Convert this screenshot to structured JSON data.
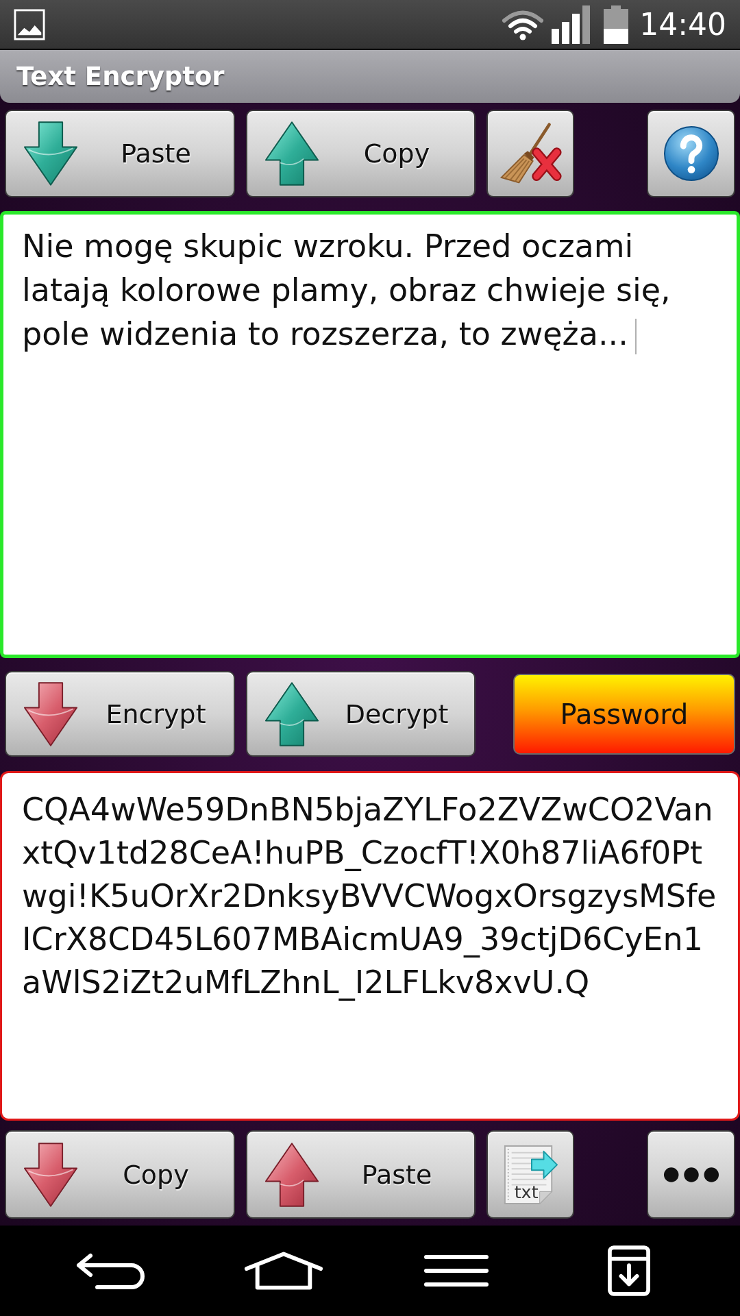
{
  "status_bar": {
    "time": "14:40"
  },
  "app_bar": {
    "title": "Text Encryptor"
  },
  "input_toolbar": {
    "paste": {
      "label": "Paste"
    },
    "copy": {
      "label": "Copy"
    }
  },
  "plain_text_field": {
    "value": "Nie mogę skupic wzroku. Przed oczami latają kolorowe plamy, obraz chwieje się, pole widzenia to rozszerza, to zwęża...",
    "focused": true
  },
  "action_toolbar": {
    "encrypt": {
      "label": "Encrypt"
    },
    "decrypt": {
      "label": "Decrypt"
    },
    "password": {
      "label": "Password"
    }
  },
  "cipher_text_field": {
    "value": "CQA4wWe59DnBN5bjaZYLFo2ZVZwCO2VanxtQv1td28CeA!huPB_CzocfT!X0h87liA6f0Ptwgi!K5uOrXr2DnksyBVVCWogxOrsgzysMSfeICrX8CD45L607MBAicmUA9_39ctjD6CyEn1aWlS2iZt2uMfLZhnL_I2LFLkv8xvU.Q"
  },
  "output_toolbar": {
    "copy": {
      "label": "Copy"
    },
    "paste": {
      "label": "Paste"
    },
    "file_button": {
      "icon_text": "txt"
    }
  }
}
